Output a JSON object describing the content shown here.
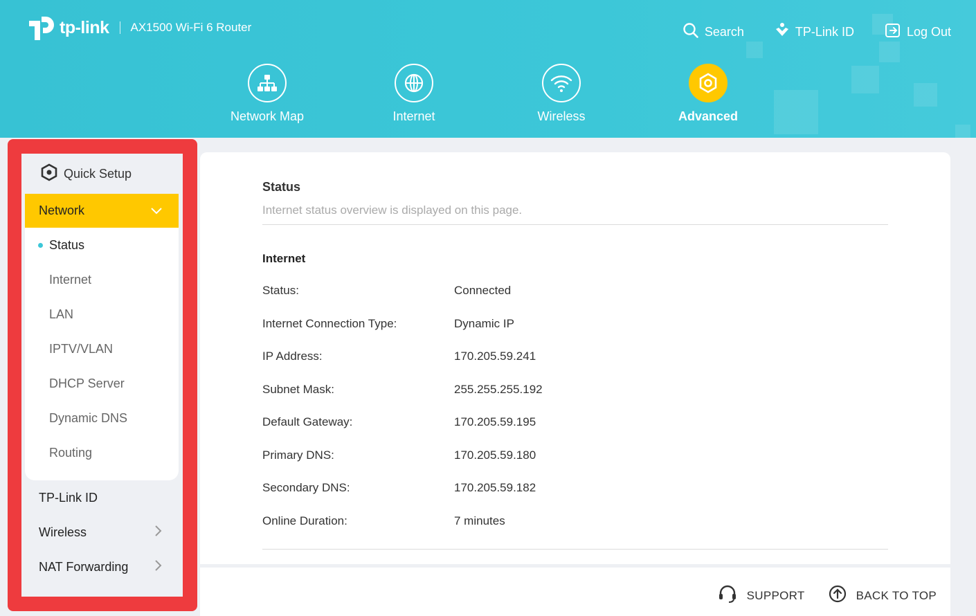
{
  "header": {
    "brand": "tp-link",
    "model": "AX1500 Wi-Fi 6 Router",
    "links": {
      "search": "Search",
      "tplink_id": "TP-Link ID",
      "logout": "Log Out"
    },
    "nav": [
      "Network Map",
      "Internet",
      "Wireless",
      "Advanced"
    ],
    "active_nav": "Advanced"
  },
  "sidebar": {
    "quick_setup": "Quick Setup",
    "network": "Network",
    "network_items": [
      "Status",
      "Internet",
      "LAN",
      "IPTV/VLAN",
      "DHCP Server",
      "Dynamic DNS",
      "Routing"
    ],
    "active_item": "Status",
    "items": [
      "TP-Link ID",
      "Wireless",
      "NAT Forwarding"
    ]
  },
  "main": {
    "title": "Status",
    "description": "Internet status overview is displayed on this page.",
    "section": "Internet",
    "rows": [
      {
        "label": "Status:",
        "value": "Connected"
      },
      {
        "label": "Internet Connection Type:",
        "value": "Dynamic IP"
      },
      {
        "label": "IP Address:",
        "value": "170.205.59.241"
      },
      {
        "label": "Subnet Mask:",
        "value": "255.255.255.192"
      },
      {
        "label": "Default Gateway:",
        "value": "170.205.59.195"
      },
      {
        "label": "Primary DNS:",
        "value": "170.205.59.180"
      },
      {
        "label": "Secondary DNS:",
        "value": "170.205.59.182"
      },
      {
        "label": "Online Duration:",
        "value": "7 minutes"
      }
    ]
  },
  "footer": {
    "support": "SUPPORT",
    "back_to_top": "BACK TO TOP"
  },
  "colors": {
    "header": "#3cc7d8",
    "accent": "#ffc800",
    "highlight_frame": "#ee3b3e"
  }
}
